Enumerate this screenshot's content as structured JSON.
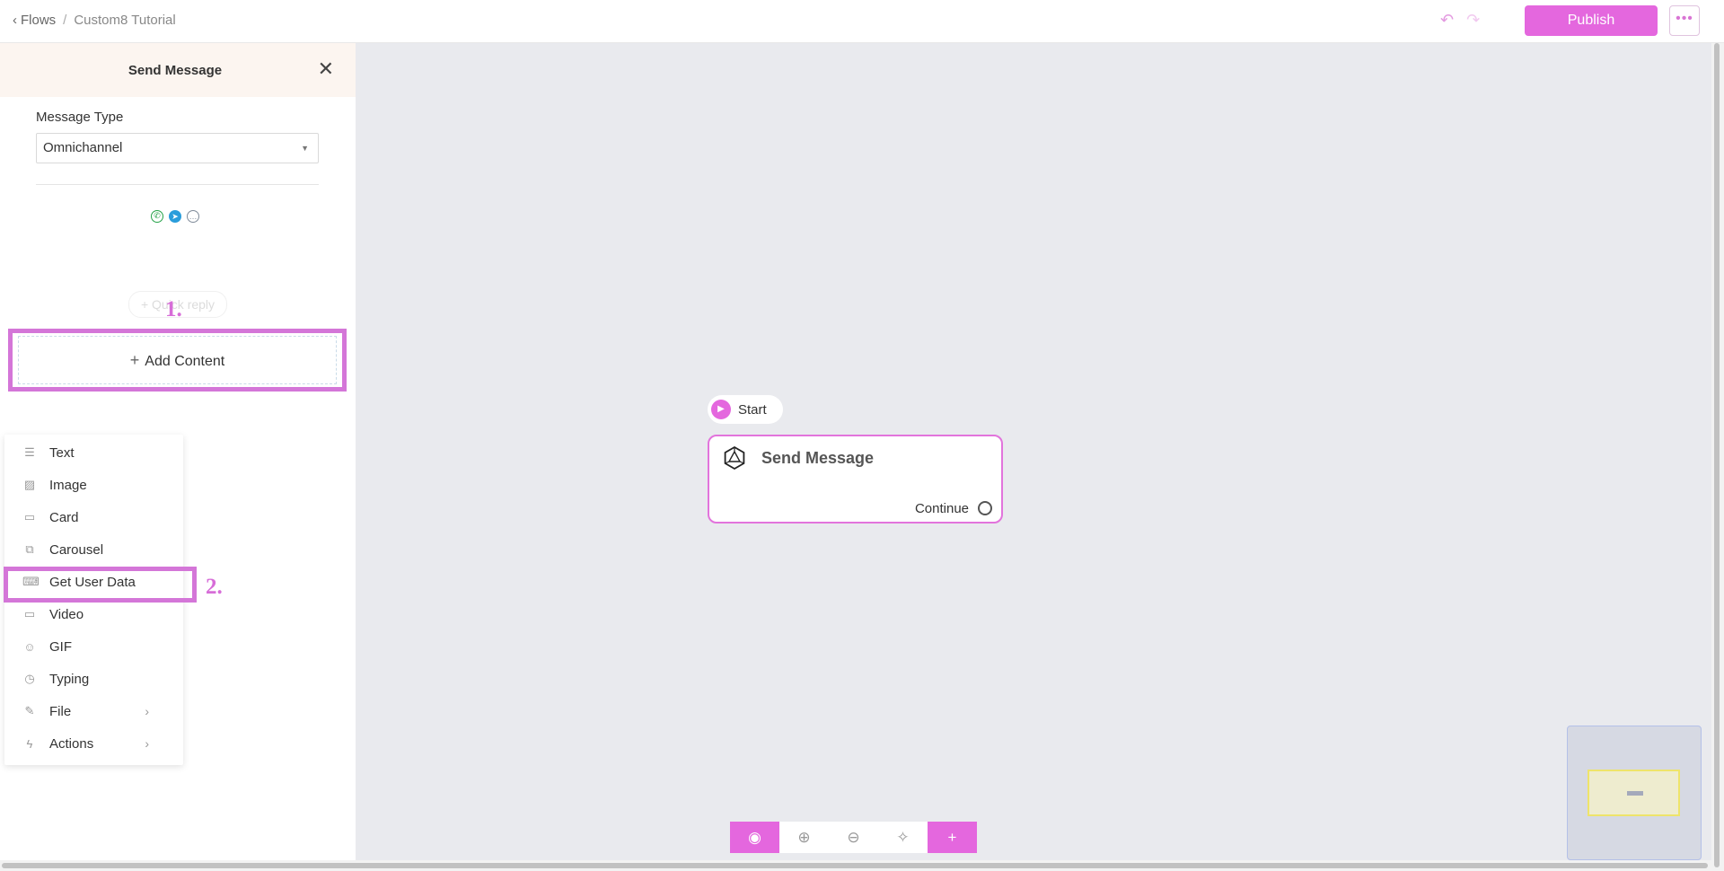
{
  "header": {
    "breadcrumb": {
      "back_label": "Flows",
      "separator": "/",
      "current": "Custom8 Tutorial"
    },
    "publish_label": "Publish",
    "more_label": "•••"
  },
  "panel": {
    "title": "Send Message",
    "message_type_label": "Message Type",
    "message_type_value": "Omnichannel",
    "quick_reply_label": "+ Quick reply",
    "add_content_label": "Add Content",
    "step1_label": "1.",
    "step2_label": "2."
  },
  "menu": {
    "items": [
      {
        "label": "Text",
        "icon": "text-icon"
      },
      {
        "label": "Image",
        "icon": "image-icon"
      },
      {
        "label": "Card",
        "icon": "card-icon"
      },
      {
        "label": "Carousel",
        "icon": "carousel-icon"
      },
      {
        "label": "Get User Data",
        "icon": "keyboard-icon"
      },
      {
        "label": "Video",
        "icon": "video-icon"
      },
      {
        "label": "GIF",
        "icon": "gif-icon"
      },
      {
        "label": "Typing",
        "icon": "clock-icon"
      },
      {
        "label": "File",
        "icon": "paperclip-icon",
        "has_submenu": true
      },
      {
        "label": "Actions",
        "icon": "lightning-icon",
        "has_submenu": true
      }
    ]
  },
  "canvas": {
    "start_label": "Start",
    "node_title": "Send Message",
    "node_output_label": "Continue"
  },
  "colors": {
    "accent": "#e467de",
    "highlight": "#d476d8",
    "canvas_bg": "#e9eaee"
  }
}
